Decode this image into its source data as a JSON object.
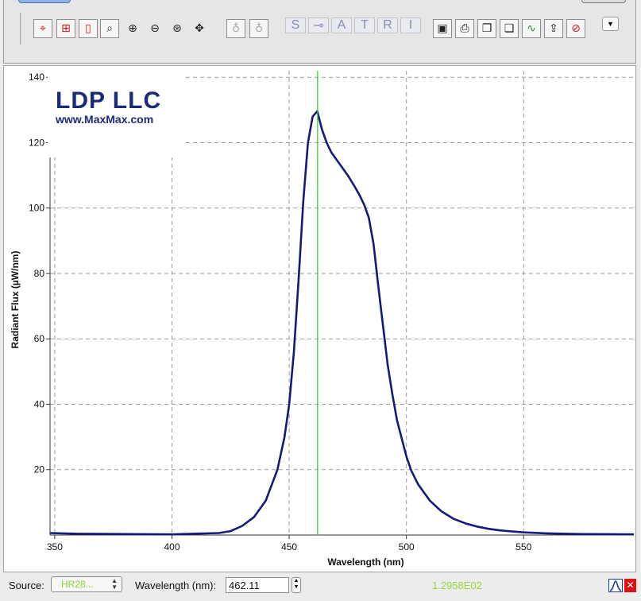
{
  "toolbar": {
    "letter_buttons": [
      "S",
      "A",
      "T",
      "R",
      "I"
    ]
  },
  "logo": {
    "title": "LDP LLC",
    "url": "www.MaxMax.com"
  },
  "status": {
    "source_label": "Source:",
    "source_value": "HR28...",
    "wavelength_label": "Wavelength (nm):",
    "wavelength_value": "462.11",
    "readout": "1.2958E02"
  },
  "chart_data": {
    "type": "line",
    "title": "",
    "xlabel": "Wavelength (nm)",
    "ylabel": "Radiant Flux (µW/nm)",
    "xlim": [
      348,
      597
    ],
    "ylim": [
      0,
      142
    ],
    "x_ticks": [
      350,
      400,
      450,
      500,
      550
    ],
    "y_ticks": [
      20,
      40,
      60,
      80,
      100,
      120,
      140
    ],
    "grid": true,
    "line_color": "#141a7a",
    "cursor_color": "#2fcc2f",
    "cursor_x": 462.11,
    "series": [
      {
        "x": [
          348,
          360,
          380,
          400,
          420,
          425,
          430,
          435,
          440,
          445,
          448,
          450,
          452,
          454,
          456,
          458,
          460,
          462,
          464,
          466,
          468,
          470,
          472,
          475,
          478,
          480,
          482,
          484,
          486,
          488,
          490,
          492,
          494,
          496,
          498,
          500,
          502,
          505,
          510,
          515,
          520,
          525,
          530,
          535,
          540,
          550,
          560,
          575,
          597
        ],
        "y": [
          0.6,
          0.4,
          0.3,
          0.2,
          0.6,
          1.2,
          2.8,
          5.5,
          10.5,
          20,
          30,
          40,
          56,
          78,
          102,
          120,
          128,
          129.6,
          124,
          120,
          117,
          115,
          113,
          110,
          106.5,
          104,
          101,
          97,
          89,
          76,
          64,
          52,
          43,
          35,
          29.5,
          24,
          19.8,
          15.5,
          10.5,
          7.2,
          5,
          3.6,
          2.6,
          1.9,
          1.4,
          0.8,
          0.5,
          0.3,
          0.2
        ]
      }
    ]
  }
}
